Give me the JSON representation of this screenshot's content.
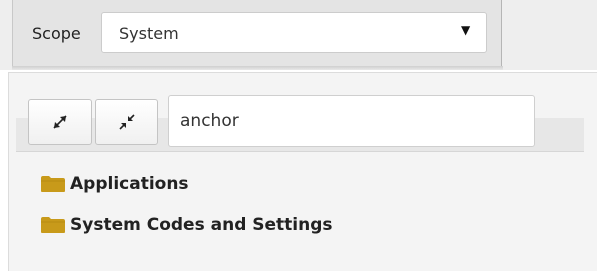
{
  "scope": {
    "label": "Scope",
    "selected": "System"
  },
  "toolbar": {
    "expand_all_icon": "expand-arrows-icon",
    "collapse_all_icon": "collapse-arrows-icon",
    "search_value": "anchor"
  },
  "tree": {
    "items": [
      {
        "label": "Applications",
        "icon": "folder-icon"
      },
      {
        "label": "System Codes and Settings",
        "icon": "folder-icon"
      }
    ]
  },
  "colors": {
    "folder": "#c89a1a",
    "topbar": "#eeeeee",
    "panel": "#f4f4f4"
  }
}
